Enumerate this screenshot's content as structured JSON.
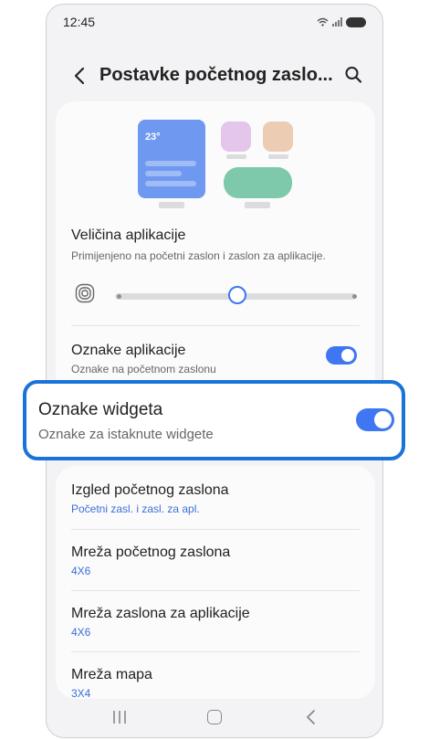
{
  "status_bar": {
    "time": "12:45"
  },
  "header": {
    "title": "Postavke početnog zaslo..."
  },
  "preview": {
    "temperature": "23°"
  },
  "app_size": {
    "title": "Veličina aplikacije",
    "subtitle": "Primijenjeno na početni zaslon i zaslon za aplikacije.",
    "slider_steps": 3,
    "slider_selected_step": 2
  },
  "app_labels": {
    "title": "Oznake aplikacije",
    "subtitle": "Oznake na početnom zaslonu",
    "enabled": true
  },
  "widget_labels": {
    "title": "Oznake widgeta",
    "subtitle": "Oznake za istaknute widgete",
    "enabled": true
  },
  "settings_list": [
    {
      "title": "Izgled početnog zaslona",
      "value": "Početni zasl. i zasl. za apl."
    },
    {
      "title": "Mreža početnog zaslona",
      "value": "4X6"
    },
    {
      "title": "Mreža zaslona za aplikacije",
      "value": "4X6"
    },
    {
      "title": "Mreža mapa",
      "value": "3X4"
    }
  ],
  "colors": {
    "accent": "#3f76f2",
    "highlight_border": "#1a73d9",
    "link_value": "#3a6fd8",
    "background": "#f3f3f5"
  },
  "icons": [
    "wifi-icon",
    "signal-icon",
    "battery-icon",
    "back-arrow-icon",
    "search-icon",
    "app-size-icon",
    "recent-apps-icon",
    "home-icon",
    "nav-back-icon"
  ]
}
